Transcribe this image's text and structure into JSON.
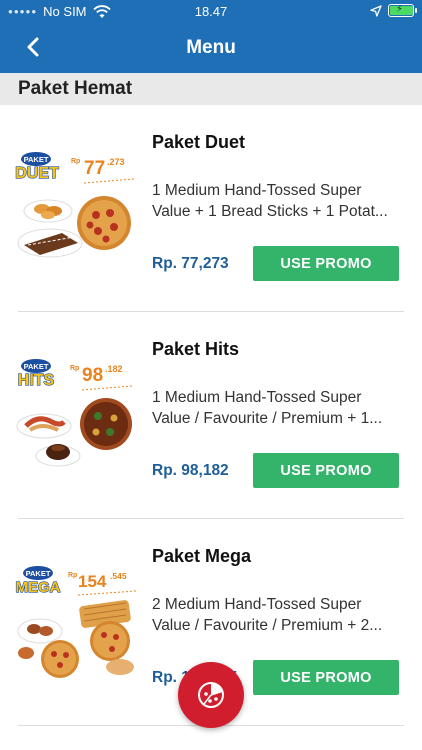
{
  "status_bar": {
    "carrier": "No SIM",
    "time": "18.47",
    "battery_level": 0.95,
    "battery_color": "#4cd964"
  },
  "navbar": {
    "title": "Menu",
    "back_icon": "chevron-left-icon"
  },
  "section": {
    "title": "Paket Hemat"
  },
  "items": [
    {
      "title": "Paket Duet",
      "description": "1 Medium Hand-Tossed Super Value + 1 Bread Sticks + 1 Potat...",
      "price": "Rp. 77,273",
      "button_label": "USE PROMO",
      "badge": {
        "line1": "PAKET",
        "line2": "DUET",
        "rp": "Rp",
        "amount": "77",
        "decimals": ".273"
      }
    },
    {
      "title": "Paket Hits",
      "description": "1 Medium Hand-Tossed Super Value / Favourite / Premium + 1...",
      "price": "Rp. 98,182",
      "button_label": "USE PROMO",
      "badge": {
        "line1": "PAKET",
        "line2": "HITS",
        "rp": "Rp",
        "amount": "98",
        "decimals": ".182"
      }
    },
    {
      "title": "Paket Mega",
      "description": "2 Medium Hand-Tossed Super Value / Favourite / Premium + 2...",
      "price": "Rp. 154,545",
      "button_label": "USE PROMO",
      "badge": {
        "line1": "PAKET",
        "line2": "MEGA",
        "rp": "Rp",
        "amount": "154",
        "decimals": ".545"
      }
    }
  ],
  "fab": {
    "icon": "pizza-icon"
  },
  "colors": {
    "header": "#1f6fb6",
    "section_bg": "#e9e9e9",
    "price": "#1f5e96",
    "button": "#34b36b",
    "fab": "#d01e2e",
    "badge_blue": "#1d4fa0",
    "badge_yellow": "#f7c21a",
    "badge_price": "#e8831e"
  }
}
